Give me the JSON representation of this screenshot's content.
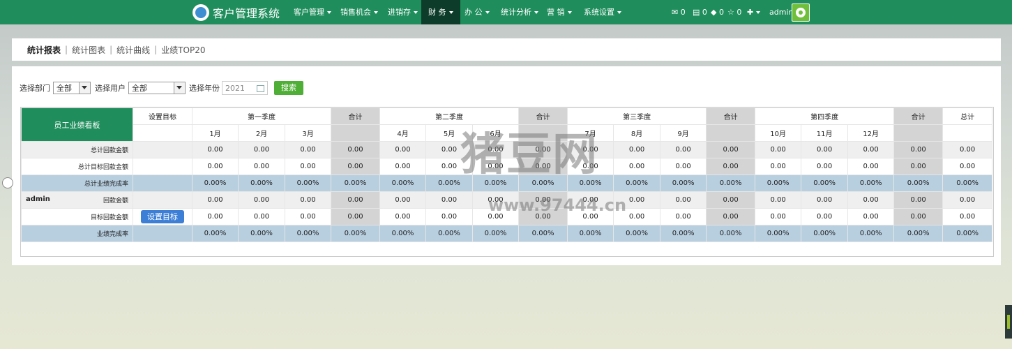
{
  "app": {
    "title": "客户管理系统"
  },
  "nav": {
    "items": [
      {
        "label": "客户管理",
        "has_caret": true
      },
      {
        "label": "销售机会",
        "has_caret": true
      },
      {
        "label": "进销存",
        "has_caret": true
      },
      {
        "label": "财 务",
        "has_caret": true,
        "active": true
      },
      {
        "label": "办 公",
        "has_caret": true
      },
      {
        "label": "统计分析",
        "has_caret": true
      },
      {
        "label": "营 销",
        "has_caret": true
      },
      {
        "label": "系统设置",
        "has_caret": true
      }
    ],
    "badges": {
      "mail": "0",
      "message": "0",
      "task": "0",
      "star": "0"
    },
    "user": "admin"
  },
  "tabs": [
    "统计报表",
    "统计图表",
    "统计曲线",
    "业绩TOP20"
  ],
  "filters": {
    "dept_label": "选择部门",
    "dept_value": "全部",
    "user_label": "选择用户",
    "user_value": "全部",
    "year_label": "选择年份",
    "year_value": "2021",
    "search_button": "搜索"
  },
  "table": {
    "board_title": "员工业绩看板",
    "set_target_header": "设置目标",
    "quarters": [
      "第一季度",
      "第二季度",
      "第三季度",
      "第四季度"
    ],
    "subtotal_label": "合计",
    "total_label": "总计",
    "months": [
      "1月",
      "2月",
      "3月",
      "4月",
      "5月",
      "6月",
      "7月",
      "8月",
      "9月",
      "10月",
      "11月",
      "12月"
    ],
    "summary_rows": [
      {
        "label": "总计回款金额",
        "values": [
          "0.00",
          "0.00",
          "0.00",
          "0.00",
          "0.00",
          "0.00",
          "0.00",
          "0.00",
          "0.00",
          "0.00",
          "0.00",
          "0.00",
          "0.00",
          "0.00",
          "0.00",
          "0.00",
          "0.00"
        ]
      },
      {
        "label": "总计目标回款金额",
        "values": [
          "0.00",
          "0.00",
          "0.00",
          "0.00",
          "0.00",
          "0.00",
          "0.00",
          "0.00",
          "0.00",
          "0.00",
          "0.00",
          "0.00",
          "0.00",
          "0.00",
          "0.00",
          "0.00",
          "0.00"
        ]
      },
      {
        "label": "总计业绩完成率",
        "values": [
          "0.00%",
          "0.00%",
          "0.00%",
          "0.00%",
          "0.00%",
          "0.00%",
          "0.00%",
          "0.00%",
          "0.00%",
          "0.00%",
          "0.00%",
          "0.00%",
          "0.00%",
          "0.00%",
          "0.00%",
          "0.00%",
          "0.00%"
        ]
      }
    ],
    "user_block": {
      "user": "admin",
      "set_button": "设置目标",
      "rows": [
        {
          "label": "回款金额",
          "values": [
            "0.00",
            "0.00",
            "0.00",
            "0.00",
            "0.00",
            "0.00",
            "0.00",
            "0.00",
            "0.00",
            "0.00",
            "0.00",
            "0.00",
            "0.00",
            "0.00",
            "0.00",
            "0.00",
            "0.00"
          ]
        },
        {
          "label": "目标回款金额",
          "values": [
            "0.00",
            "0.00",
            "0.00",
            "0.00",
            "0.00",
            "0.00",
            "0.00",
            "0.00",
            "0.00",
            "0.00",
            "0.00",
            "0.00",
            "0.00",
            "0.00",
            "0.00",
            "0.00",
            "0.00"
          ]
        },
        {
          "label": "业绩完成率",
          "values": [
            "0.00%",
            "0.00%",
            "0.00%",
            "0.00%",
            "0.00%",
            "0.00%",
            "0.00%",
            "0.00%",
            "0.00%",
            "0.00%",
            "0.00%",
            "0.00%",
            "0.00%",
            "0.00%",
            "0.00%",
            "0.00%",
            "0.00%"
          ]
        }
      ]
    }
  },
  "watermark": {
    "text": "猪豆网",
    "url": "www.97444.cn"
  }
}
